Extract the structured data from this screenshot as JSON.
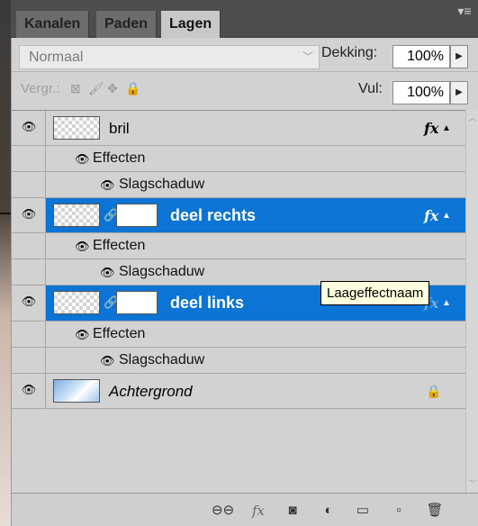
{
  "tabs": [
    "Kanalen",
    "Paden",
    "Lagen"
  ],
  "active_tab": "Lagen",
  "panel_menu_icon": "panel-menu-icon",
  "blend_mode": "Normaal",
  "opacity_label": "Dekking:",
  "opacity_value": "100%",
  "lock_label": "Vergr.:",
  "fill_label": "Vul:",
  "fill_value": "100%",
  "layers": [
    {
      "name": "bril",
      "fx": "fx",
      "effects_label": "Effecten",
      "effect": "Slagschaduw",
      "selected": false
    },
    {
      "name": "deel rechts",
      "fx": "fx",
      "effects_label": "Effecten",
      "effect": "Slagschaduw",
      "selected": true
    },
    {
      "name": "deel links",
      "fx": "fx",
      "effects_label": "Effecten",
      "effect": "Slagschaduw",
      "selected": true
    },
    {
      "name": "Achtergrond",
      "locked": true,
      "selected": false
    }
  ],
  "tooltip": "Laageffectnaam",
  "colors": {
    "selection": "#0b74d4",
    "panel": "#d2d2d2",
    "tab_bar": "#4e4e4e"
  },
  "bottom_icons": [
    "link-icon",
    "fx-icon",
    "mask-icon",
    "adjustment-icon",
    "group-icon",
    "new-layer-icon",
    "trash-icon"
  ],
  "bottom_fx_label": "fx"
}
